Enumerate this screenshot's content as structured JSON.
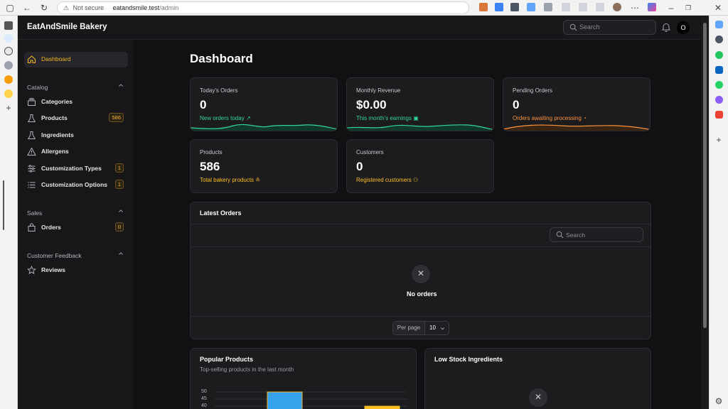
{
  "browser": {
    "not_secure": "Not secure",
    "url_host": "eatandsmile.test",
    "url_path": "/admin"
  },
  "app": {
    "brand": "EatAndSmile Bakery",
    "search_placeholder": "Search",
    "avatar_initial": "O"
  },
  "sidebar": {
    "dashboard": "Dashboard",
    "groups": [
      {
        "label": "Catalog",
        "items": [
          {
            "label": "Categories",
            "badge": ""
          },
          {
            "label": "Products",
            "badge": "586"
          },
          {
            "label": "Ingredients",
            "badge": ""
          },
          {
            "label": "Allergens",
            "badge": ""
          },
          {
            "label": "Customization Types",
            "badge": "1"
          },
          {
            "label": "Customization Options",
            "badge": "1"
          }
        ]
      },
      {
        "label": "Sales",
        "items": [
          {
            "label": "Orders",
            "badge": "0"
          }
        ]
      },
      {
        "label": "Customer Feedback",
        "items": [
          {
            "label": "Reviews",
            "badge": ""
          }
        ]
      }
    ]
  },
  "main": {
    "title": "Dashboard",
    "stats": [
      {
        "label": "Today's Orders",
        "value": "0",
        "desc": "New orders today",
        "color": "#34d399"
      },
      {
        "label": "Monthly Revenue",
        "value": "$0.00",
        "desc": "This month's earnings",
        "color": "#34d399"
      },
      {
        "label": "Pending Orders",
        "value": "0",
        "desc": "Orders awaiting processing",
        "color": "#fb923c"
      },
      {
        "label": "Products",
        "value": "586",
        "desc": "Total bakery products",
        "color": "#fbbf24"
      },
      {
        "label": "Customers",
        "value": "0",
        "desc": "Registered customers",
        "color": "#fbbf24"
      }
    ],
    "latest_orders": {
      "title": "Latest Orders",
      "search_placeholder": "Search",
      "empty": "No orders",
      "per_page_label": "Per page",
      "per_page_value": "10"
    },
    "popular_products": {
      "title": "Popular Products",
      "subtitle": "Top-selling products in the last month"
    },
    "low_stock": {
      "title": "Low Stock Ingredients"
    }
  },
  "chart_data": {
    "type": "bar",
    "title": "Popular Products",
    "y_ticks": [
      "50",
      "45",
      "40"
    ],
    "ylim": [
      40,
      50
    ],
    "values": [
      50,
      40
    ],
    "colors": [
      "#36a2eb",
      "#fbbf24"
    ]
  },
  "colors": {
    "accent": "#f0b429",
    "background": "#111113",
    "card": "#1c1c1f"
  }
}
